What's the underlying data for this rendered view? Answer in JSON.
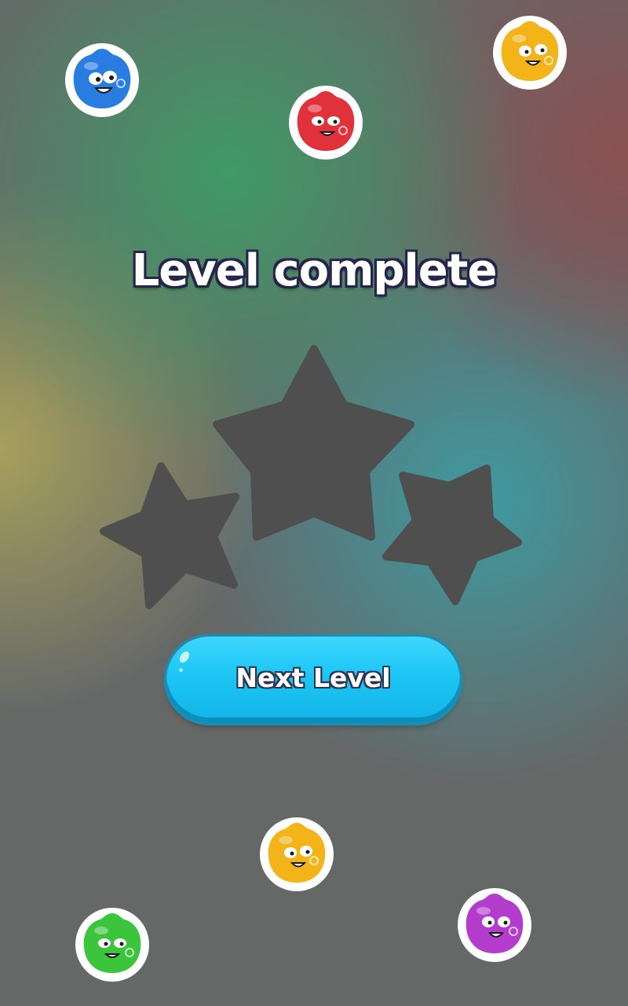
{
  "screen": {
    "title": "Level complete",
    "next_button_label": "Next Level"
  },
  "stars": {
    "earned": 0,
    "total": 3,
    "empty_color": "#4f4f4f"
  },
  "background_colors": {
    "green": "#3f9a67",
    "red": "#8a5052",
    "yellow": "#a6a05c",
    "teal": "#3e9aa0",
    "gray": "#666868"
  },
  "button_color": "#1cc6f4",
  "title_outline_color": "#26244a",
  "decorations": [
    {
      "name": "blue-jelly-icon",
      "color": "#2a7de0"
    },
    {
      "name": "red-jelly-icon",
      "color": "#e0323a"
    },
    {
      "name": "yellow-jelly-icon",
      "color": "#f2b419"
    },
    {
      "name": "yellow-jelly-icon",
      "color": "#f2b419"
    },
    {
      "name": "green-jelly-icon",
      "color": "#3cc43c"
    },
    {
      "name": "purple-jelly-icon",
      "color": "#b43ccc"
    }
  ]
}
